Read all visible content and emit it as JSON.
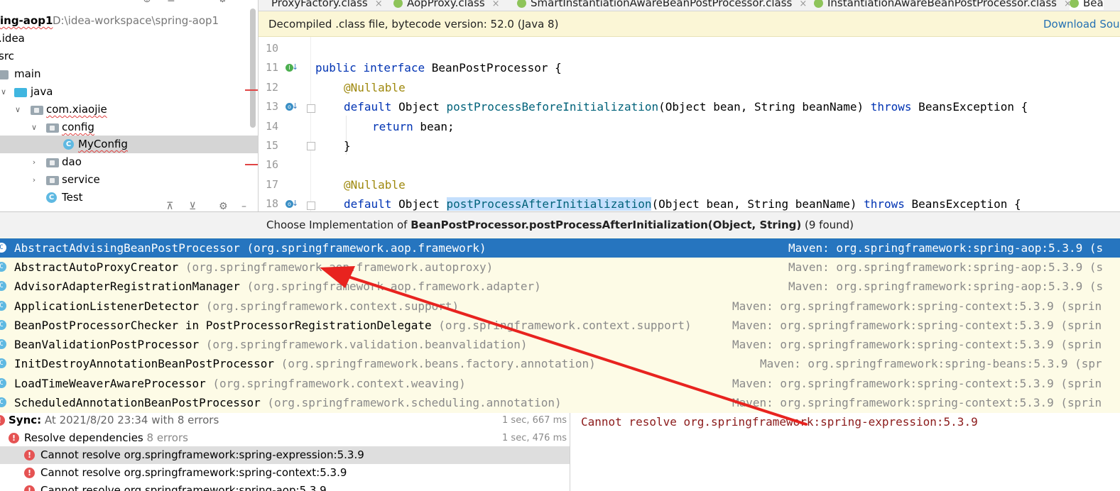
{
  "tabs": [
    {
      "label": "ProxyFactory.class",
      "close": "×"
    },
    {
      "label": "AopProxy.class",
      "close": "×"
    },
    {
      "label": "SmartInstantiationAwareBeanPostProcessor.class",
      "close": "×"
    },
    {
      "label": "InstantiationAwareBeanPostProcessor.class",
      "close": "×"
    },
    {
      "label": "Bea"
    }
  ],
  "project": {
    "root_name": "ing-aop1",
    "root_path": "D:\\idea-workspace\\spring-aop1",
    "items": [
      {
        "label": ".idea"
      },
      {
        "label": "src"
      },
      {
        "label": "main"
      },
      {
        "label": "java"
      },
      {
        "label": "com.xiaojie"
      },
      {
        "label": "config"
      },
      {
        "label": "MyConfig"
      },
      {
        "label": "dao"
      },
      {
        "label": "service"
      },
      {
        "label": "Test"
      }
    ]
  },
  "banner": {
    "text": "Decompiled .class file, bytecode version: 52.0 (Java 8)",
    "link": "Download Sou"
  },
  "code": {
    "line_numbers": [
      "10",
      "11",
      "12",
      "13",
      "14",
      "15",
      "16",
      "17",
      "18"
    ],
    "l11_kw1": "public",
    "l11_kw2": "interface",
    "l11_rest": " BeanPostProcessor {",
    "l12_ann": "@Nullable",
    "l13_kw": "default",
    "l13_obj": " Object ",
    "l13_fn": "postProcessBeforeInitialization",
    "l13_params": "(Object bean, String beanName) ",
    "l13_throws": "throws",
    "l13_rest": " BeansException {",
    "l14_kw": "return",
    "l14_rest": " bean;",
    "l15": "}",
    "l17_ann": "@Nullable",
    "l18_kw": "default",
    "l18_obj": " Object ",
    "l18_fn": "postProcessAfterInitialization",
    "l18_params": "(Object bean, String beanName) ",
    "l18_throws": "throws",
    "l18_rest": " BeansException {"
  },
  "popup": {
    "title_prefix": "Choose Implementation of ",
    "title_method": "BeanPostProcessor.postProcessAfterInitialization(Object, String)",
    "title_suffix": " (9 found)",
    "items": [
      {
        "name": "AbstractAdvisingBeanPostProcessor",
        "pkg": " (org.springframework.aop.framework)",
        "maven": "Maven: org.springframework:spring-aop:5.3.9 (s"
      },
      {
        "name": "AbstractAutoProxyCreator",
        "pkg": " (org.springframework.aop.framework.autoproxy)",
        "maven": "Maven: org.springframework:spring-aop:5.3.9 (s"
      },
      {
        "name": "AdvisorAdapterRegistrationManager",
        "pkg": " (org.springframework.aop.framework.adapter)",
        "maven": "Maven: org.springframework:spring-aop:5.3.9 (s"
      },
      {
        "name": "ApplicationListenerDetector",
        "pkg": " (org.springframework.context.support)",
        "maven": "Maven: org.springframework:spring-context:5.3.9 (sprin"
      },
      {
        "name": "BeanPostProcessorChecker in PostProcessorRegistrationDelegate",
        "pkg": " (org.springframework.context.support)",
        "maven": "Maven: org.springframework:spring-context:5.3.9 (sprin"
      },
      {
        "name": "BeanValidationPostProcessor",
        "pkg": " (org.springframework.validation.beanvalidation)",
        "maven": "Maven: org.springframework:spring-context:5.3.9 (sprin"
      },
      {
        "name": "InitDestroyAnnotationBeanPostProcessor",
        "pkg": " (org.springframework.beans.factory.annotation)",
        "maven": "Maven: org.springframework:spring-beans:5.3.9 (spr"
      },
      {
        "name": "LoadTimeWeaverAwareProcessor",
        "pkg": " (org.springframework.context.weaving)",
        "maven": "Maven: org.springframework:spring-context:5.3.9 (sprin"
      },
      {
        "name": "ScheduledAnnotationBeanPostProcessor",
        "pkg": " (org.springframework.scheduling.annotation)",
        "maven": "Maven: org.springframework:spring-context:5.3.9 (sprin"
      }
    ]
  },
  "build": {
    "sync_label": "Sync:",
    "sync_detail": " At 2021/8/20 23:34 with 8 errors",
    "sync_time": "1 sec, 667 ms",
    "resolve_label": "Resolve dependencies",
    "resolve_errors": " 8 errors",
    "resolve_time": "1 sec, 476 ms",
    "errors": [
      "Cannot resolve org.springframework:spring-expression:5.3.9",
      "Cannot resolve org.springframework:spring-context:5.3.9",
      "Cannot resolve org.springframework:spring-aop:5.3.9"
    ],
    "message": "Cannot resolve org.springframework:spring-expression:5.3.9"
  },
  "colors": {
    "selection": "#2675bf",
    "error": "#e55353",
    "arrow": "#e8231f",
    "banner": "#fbf6d6",
    "popup_bg": "#fdfbe6"
  }
}
